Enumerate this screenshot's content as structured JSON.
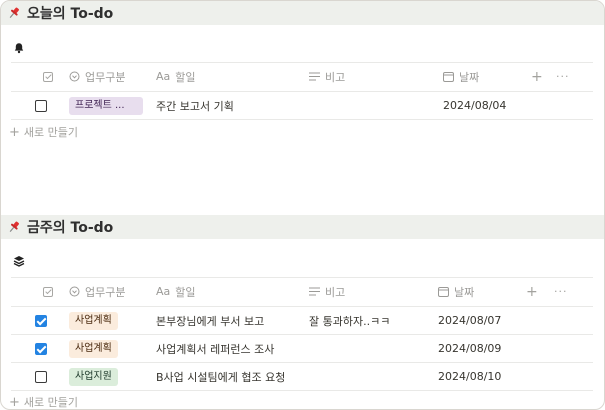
{
  "today": {
    "title": "오늘의 To-do",
    "view_icon": "bell-icon",
    "columns": {
      "category": "업무구분",
      "todo": "할일",
      "note": "비고",
      "date": "날짜"
    },
    "column_icons": {
      "category": "select-icon",
      "todo_prefix": "Aa",
      "note": "text-lines-icon",
      "date": "calendar-icon"
    },
    "rows": [
      {
        "checked": false,
        "category": "프로젝트 ...",
        "category_color": "#e8deee",
        "todo": "주간 보고서 기획",
        "note": "",
        "date": "2024/08/04"
      }
    ],
    "new_label": "새로 만들기"
  },
  "week": {
    "title": "금주의 To-do",
    "view_icon": "layers-icon",
    "columns": {
      "category": "업무구분",
      "todo": "할일",
      "note": "비고",
      "date": "날짜"
    },
    "column_icons": {
      "category": "select-icon",
      "todo_prefix": "Aa",
      "note": "text-lines-icon",
      "date": "calendar-icon"
    },
    "rows": [
      {
        "checked": true,
        "category": "사업계획",
        "category_color": "#fbecdd",
        "todo": "본부장님에게 부서 보고",
        "note": "잘 통과하자..ㅋㅋ",
        "date": "2024/08/07"
      },
      {
        "checked": true,
        "category": "사업계획",
        "category_color": "#fbecdd",
        "todo": "사업계획서 레퍼런스 조사",
        "note": "",
        "date": "2024/08/09"
      },
      {
        "checked": false,
        "category": "사업지원",
        "category_color": "#dbeddb",
        "todo": "B사업 시설팀에게 협조 요청",
        "note": "",
        "date": "2024/08/10"
      }
    ],
    "new_label": "새로 만들기"
  },
  "header_actions": {
    "add": "+",
    "more": "···"
  }
}
